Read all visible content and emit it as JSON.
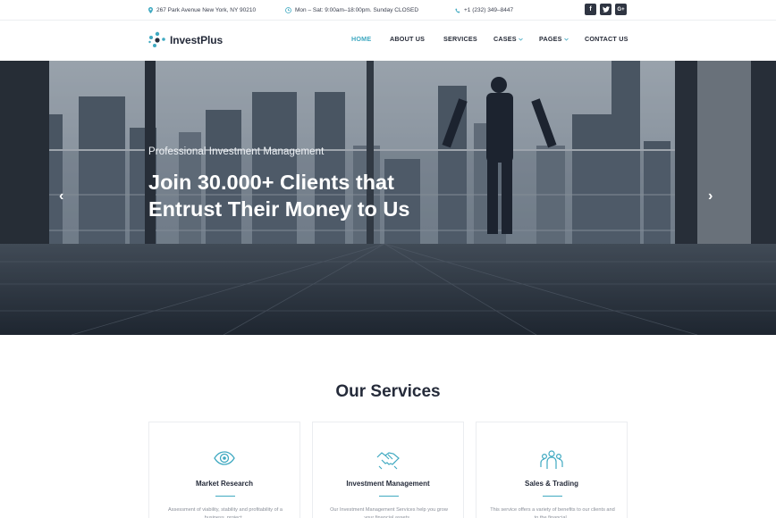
{
  "topbar": {
    "address": "267 Park Avenue New York, NY 90210",
    "hours": "Mon – Sat: 9:00am–18:00pm. Sunday CLOSED",
    "phone": "+1 (232) 349–8447",
    "social": [
      {
        "icon": "facebook-icon",
        "glyph": "f"
      },
      {
        "icon": "twitter-icon",
        "glyph": "t"
      },
      {
        "icon": "google-plus-icon",
        "glyph": "G+"
      }
    ]
  },
  "brand": {
    "name": "InvestPlus"
  },
  "nav": {
    "home": "HOME",
    "about": "ABOUT US",
    "services": "SERVICES",
    "cases": "CASES",
    "pages": "PAGES",
    "contact": "CONTACT US"
  },
  "hero": {
    "subtitle": "Professional Investment Management",
    "title": "Join 30.000+ Clients that Entrust Their Money to Us",
    "prev_glyph": "‹",
    "next_glyph": "›"
  },
  "services": {
    "heading": "Our Services",
    "cards": [
      {
        "icon": "eye-icon",
        "title": "Market Research",
        "desc": "Assessment of viability, stability and profitability of a business, project..."
      },
      {
        "icon": "handshake-icon",
        "title": "Investment Management",
        "desc": "Our Investment Management Services help you grow your financial assets..."
      },
      {
        "icon": "team-icon",
        "title": "Sales & Trading",
        "desc": "This service offers a variety of benefits to our clients and to the financial..."
      }
    ]
  },
  "colors": {
    "accent": "#3fa9c1",
    "text_dark": "#252b3a",
    "social_bg": "#2f3542"
  }
}
